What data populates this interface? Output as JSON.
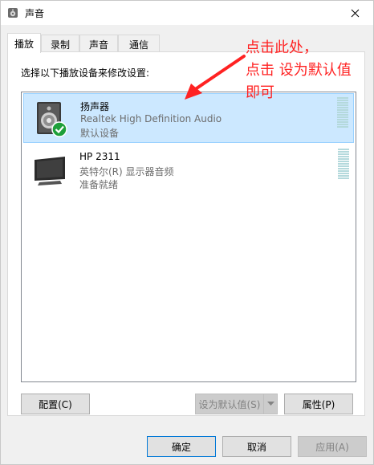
{
  "window": {
    "title": "声音"
  },
  "tabs": [
    {
      "label": "播放",
      "active": true
    },
    {
      "label": "录制",
      "active": false
    },
    {
      "label": "声音",
      "active": false
    },
    {
      "label": "通信",
      "active": false
    }
  ],
  "instruction": "选择以下播放设备来修改设置:",
  "devices": [
    {
      "name": "扬声器",
      "line1": "Realtek High Definition Audio",
      "line2": "默认设备",
      "selected": true,
      "icon": "speaker-icon"
    },
    {
      "name": "HP 2311",
      "line1": "英特尔(R) 显示器音频",
      "line2": "准备就绪",
      "selected": false,
      "icon": "monitor-icon"
    }
  ],
  "panel_buttons": {
    "configure": "配置(C)",
    "set_default": "设为默认值(S)",
    "properties": "属性(P)"
  },
  "dialog_buttons": {
    "ok": "确定",
    "cancel": "取消",
    "apply": "应用(A)"
  },
  "annotation": {
    "line1": "点击此处，",
    "line2": "点击 设为默认值",
    "line3": "即可",
    "color": "#ff2222"
  },
  "colors": {
    "selection": "#cce8ff",
    "meter": "#b4d9dc",
    "check": "#1e9f3a"
  }
}
